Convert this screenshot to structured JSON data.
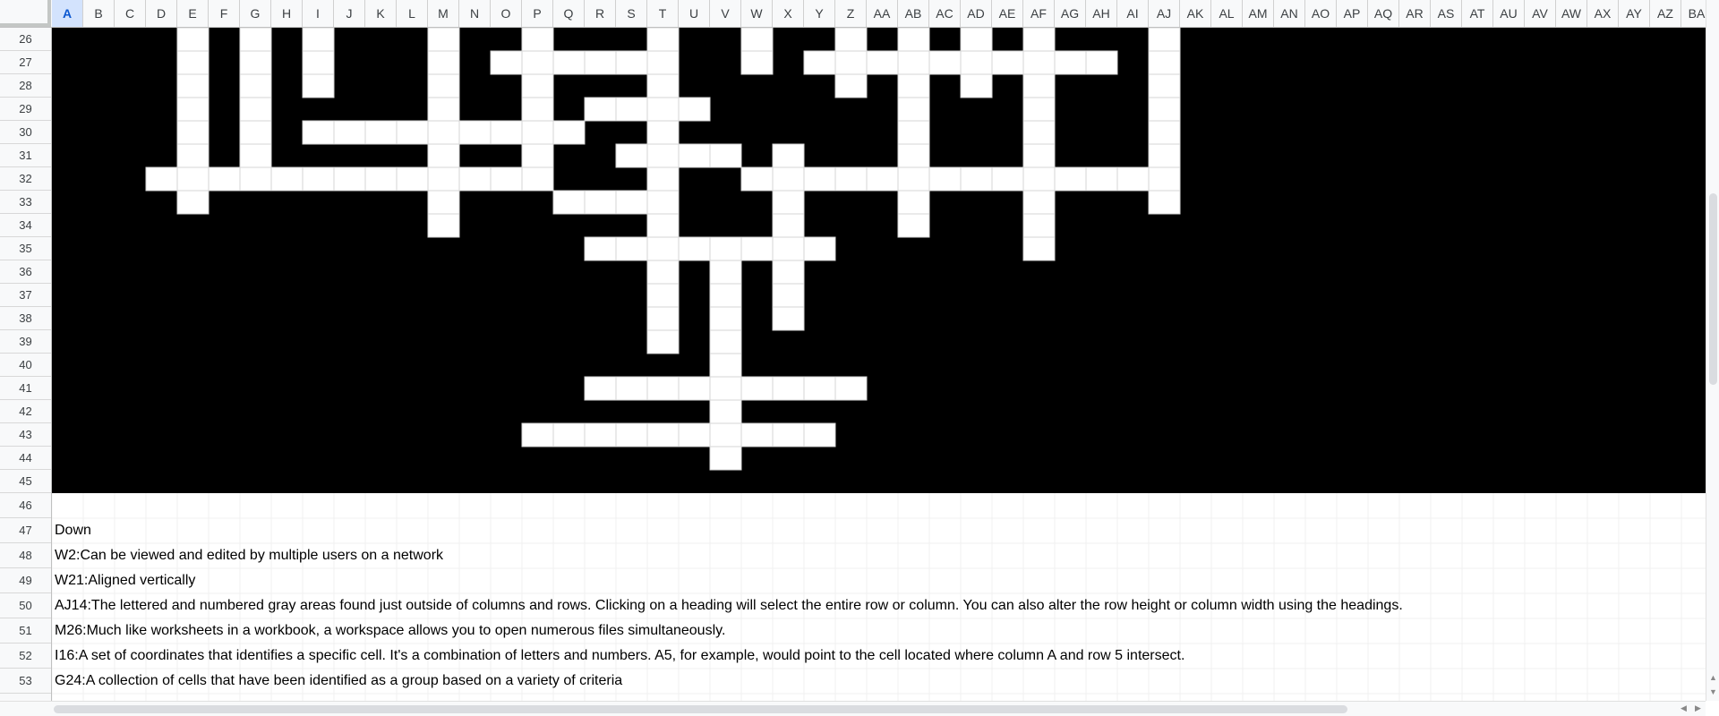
{
  "selected_column": "A",
  "columns": [
    "A",
    "B",
    "C",
    "D",
    "E",
    "F",
    "G",
    "H",
    "I",
    "J",
    "K",
    "L",
    "M",
    "N",
    "O",
    "P",
    "Q",
    "R",
    "S",
    "T",
    "U",
    "V",
    "W",
    "X",
    "Y",
    "Z",
    "AA",
    "AB",
    "AC",
    "AD",
    "AE",
    "AF",
    "AG",
    "AH",
    "AI",
    "AJ",
    "AK",
    "AL",
    "AM",
    "AN",
    "AO",
    "AP",
    "AQ",
    "AR",
    "AS",
    "AT",
    "AU",
    "AV",
    "AW",
    "AX",
    "AY",
    "AZ",
    "BA"
  ],
  "rows": [
    26,
    27,
    28,
    29,
    30,
    31,
    32,
    33,
    34,
    35,
    36,
    37,
    38,
    39,
    40,
    41,
    42,
    43,
    44,
    45,
    46,
    47,
    48,
    49,
    50,
    51,
    52,
    53
  ],
  "black_block_rows": [
    26,
    45
  ],
  "black_block_cols": [
    "A",
    "BA"
  ],
  "white_cells": {
    "26": [
      "E",
      "G",
      "I",
      "M",
      "P",
      "T",
      "W",
      "Z",
      "AB",
      "AD",
      "AF",
      "AJ"
    ],
    "27": [
      "E",
      "G",
      "I",
      "M",
      "O",
      "P",
      "Q",
      "R",
      "S",
      "T",
      "W",
      "Y",
      "Z",
      "AA",
      "AB",
      "AC",
      "AD",
      "AE",
      "AF",
      "AG",
      "AH",
      "AJ"
    ],
    "28": [
      "E",
      "G",
      "I",
      "M",
      "P",
      "T",
      "Z",
      "AB",
      "AD",
      "AF",
      "AJ"
    ],
    "29": [
      "E",
      "G",
      "M",
      "P",
      "R",
      "S",
      "T",
      "U",
      "AB",
      "AF",
      "AJ"
    ],
    "30": [
      "E",
      "G",
      "I",
      "J",
      "K",
      "L",
      "M",
      "N",
      "O",
      "P",
      "Q",
      "T",
      "AB",
      "AF",
      "AJ"
    ],
    "31": [
      "E",
      "G",
      "M",
      "P",
      "S",
      "T",
      "U",
      "V",
      "X",
      "AB",
      "AF",
      "AJ"
    ],
    "32": [
      "D",
      "E",
      "F",
      "G",
      "H",
      "I",
      "J",
      "K",
      "L",
      "M",
      "N",
      "O",
      "P",
      "T",
      "W",
      "X",
      "Y",
      "Z",
      "AA",
      "AB",
      "AC",
      "AD",
      "AE",
      "AF",
      "AG",
      "AH",
      "AI",
      "AJ"
    ],
    "33": [
      "E",
      "M",
      "Q",
      "R",
      "S",
      "T",
      "X",
      "AB",
      "AF",
      "AJ"
    ],
    "34": [
      "M",
      "T",
      "X",
      "AB",
      "AF"
    ],
    "35": [
      "R",
      "S",
      "T",
      "U",
      "V",
      "W",
      "X",
      "Y",
      "AF"
    ],
    "36": [
      "T",
      "V",
      "X"
    ],
    "37": [
      "T",
      "V",
      "X"
    ],
    "38": [
      "T",
      "V",
      "X"
    ],
    "39": [
      "T",
      "V"
    ],
    "40": [
      "V"
    ],
    "41": [
      "R",
      "S",
      "T",
      "U",
      "V",
      "W",
      "X",
      "Y",
      "Z"
    ],
    "42": [
      "V"
    ],
    "43": [
      "P",
      "Q",
      "R",
      "S",
      "T",
      "U",
      "V",
      "W",
      "X",
      "Y"
    ],
    "44": [
      "V"
    ]
  },
  "clues": [
    {
      "row": 47,
      "text": "Down"
    },
    {
      "row": 48,
      "text": "W2:Can be viewed and edited by multiple users on a network"
    },
    {
      "row": 49,
      "text": "W21:Aligned vertically"
    },
    {
      "row": 50,
      "text": "AJ14:The lettered and numbered gray areas found just outside of columns and rows. Clicking on a heading will select the entire row or column. You can also alter the row height or column width using the headings."
    },
    {
      "row": 51,
      "text": "M26:Much like worksheets in a workbook, a workspace allows you to open numerous files simultaneously."
    },
    {
      "row": 52,
      "text": "I16:A set of coordinates that identifies a specific cell. It's a combination of letters and numbers. A5, for example, would point to the cell located where column A and row 5 intersect."
    },
    {
      "row": 53,
      "text": "G24:A collection of cells that have been identified as a group based on a variety of criteria"
    }
  ],
  "colors": {
    "block": "#000000",
    "white": "#ffffff",
    "header_bg": "#f8f9fa",
    "selected_header": "#d3e3fd"
  }
}
